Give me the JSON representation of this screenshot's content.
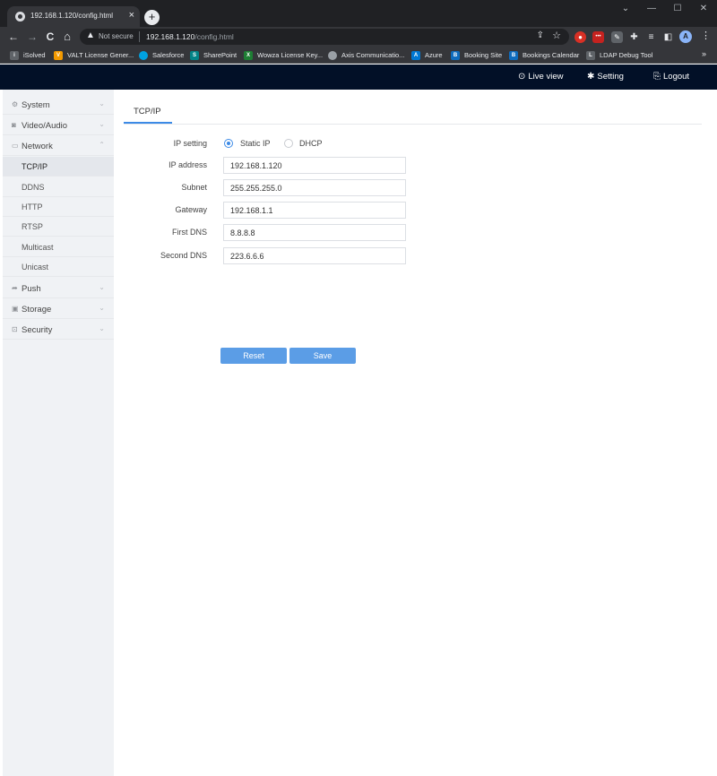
{
  "browser": {
    "tab_title": "192.168.1.120/config.html",
    "tab_close": "×",
    "new_tab": "+",
    "window_controls": [
      "⌄",
      "—",
      "☐",
      "✕"
    ],
    "nav": {
      "back": "←",
      "forward": "→",
      "reload": "C",
      "home": "⌂"
    },
    "omnibox": {
      "security_icon": "warning-triangle-icon",
      "not_secure": "Not secure",
      "host": "192.168.1.120",
      "path": "/config.html"
    },
    "profile_initial": "A",
    "bookmarks": [
      {
        "label": "iSolved",
        "icon_color": "#5f6368",
        "glyph": "i"
      },
      {
        "label": "VALT License Gener...",
        "icon_color": "#f29900",
        "glyph": "V"
      },
      {
        "label": "Salesforce",
        "icon_color": "#00a1e0",
        "glyph": ""
      },
      {
        "label": "SharePoint",
        "icon_color": "#038387",
        "glyph": "S"
      },
      {
        "label": "Wowza License Key...",
        "icon_color": "#1e7e34",
        "glyph": "X"
      },
      {
        "label": "Axis Communicatio...",
        "icon_color": "#9aa0a6",
        "glyph": ""
      },
      {
        "label": "Azure",
        "icon_color": "#0078d4",
        "glyph": "A"
      },
      {
        "label": "Booking Site",
        "icon_color": "#0f6cbd",
        "glyph": "B"
      },
      {
        "label": "Bookings Calendar",
        "icon_color": "#0f6cbd",
        "glyph": "B"
      },
      {
        "label": "LDAP Debug Tool",
        "icon_color": "#5f6368",
        "glyph": "L"
      }
    ],
    "bookmarks_more": "»"
  },
  "header": {
    "live_view": "Live view",
    "setting": "Setting",
    "logout": "Logout"
  },
  "sidebar": {
    "items": [
      {
        "label": "System",
        "icon": "gear-icon",
        "glyph": "⚙",
        "chevron": "⌄"
      },
      {
        "label": "Video/Audio",
        "icon": "camera-icon",
        "glyph": "◙",
        "chevron": "⌄"
      },
      {
        "label": "Network",
        "icon": "monitor-icon",
        "glyph": "▭",
        "chevron": "⌃"
      }
    ],
    "network_sub": [
      "TCP/IP",
      "DDNS",
      "HTTP",
      "RTSP",
      "Multicast",
      "Unicast"
    ],
    "items_after": [
      {
        "label": "Push",
        "icon": "push-icon",
        "glyph": "➦",
        "chevron": "⌄"
      },
      {
        "label": "Storage",
        "icon": "disk-icon",
        "glyph": "▣",
        "chevron": "⌄"
      },
      {
        "label": "Security",
        "icon": "lock-icon",
        "glyph": "⊡",
        "chevron": "⌄"
      }
    ]
  },
  "main": {
    "tab": "TCP/IP",
    "ip_setting_label": "IP setting",
    "static_ip_label": "Static IP",
    "dhcp_label": "DHCP",
    "fields": [
      {
        "label": "IP address",
        "value": "192.168.1.120"
      },
      {
        "label": "Subnet",
        "value": "255.255.255.0"
      },
      {
        "label": "Gateway",
        "value": "192.168.1.1"
      },
      {
        "label": "First DNS",
        "value": "8.8.8.8"
      },
      {
        "label": "Second DNS",
        "value": "223.6.6.6"
      }
    ],
    "reset_label": "Reset",
    "save_label": "Save"
  }
}
